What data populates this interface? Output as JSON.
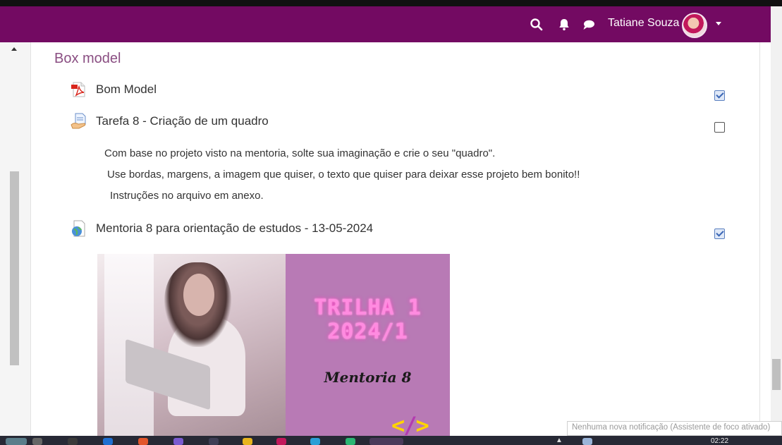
{
  "navbar": {
    "user_name": "Tatiane Souza",
    "icons": [
      "search-icon",
      "bell-icon",
      "chat-icon",
      "chevron-down-icon"
    ],
    "background": "#730a62"
  },
  "section": {
    "title": "Box model"
  },
  "activities": [
    {
      "name": "Bom Model",
      "icon": "pdf-icon",
      "completed": true
    },
    {
      "name": "Tarefa 8 - Criação de um quadro",
      "icon": "assignment-icon",
      "completed": false
    },
    {
      "name": "Mentoria 8 para orientação de estudos - 13-05-2024",
      "icon": "url-globe-icon",
      "completed": true
    }
  ],
  "assignment_description": [
    "Com base no projeto visto na mentoria, solte sua imaginação e crie o seu \"quadro\".",
    "Use bordas, margens, a imagem que quiser, o texto que quiser para deixar esse projeto bem bonito!!",
    "Instruções no arquivo em anexo."
  ],
  "banner": {
    "line1": "TRILHA 1",
    "line2": "2024/1",
    "subtitle": "Mentoria 8",
    "code_symbol_left": "<",
    "code_symbol_slash": "/",
    "code_symbol_right": ">",
    "panel_color": "#b87ab5"
  },
  "taskbar": {
    "clock": "02:22",
    "notification_toast": "Nenhuma nova notificação (Assistente de foco ativado)"
  }
}
